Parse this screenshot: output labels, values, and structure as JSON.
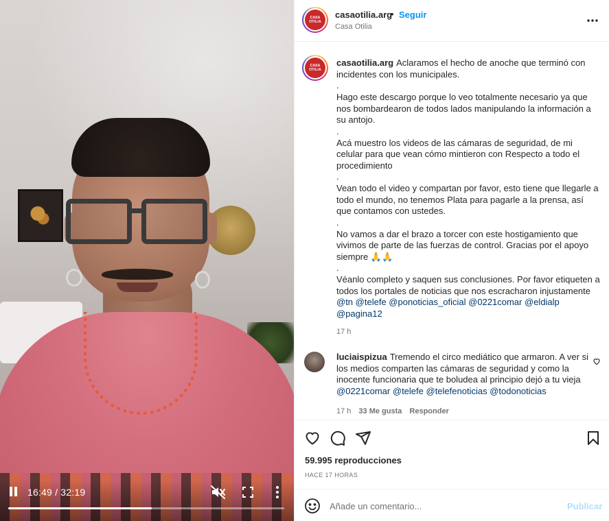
{
  "video": {
    "time": "16:49 / 32:19",
    "progress": 0.52,
    "controls": {
      "pause_icon": "pause-icon",
      "mute_icon": "volume-muted-icon",
      "fullscreen_icon": "fullscreen-icon",
      "more_icon": "more-vertical-icon"
    }
  },
  "post_header": {
    "username": "casaotilia.arg",
    "dot": "•",
    "follow_label": "Seguir",
    "subtitle": "Casa Otilia",
    "avatar_text": "CASA OTILIA",
    "more_icon": "more-horizontal-icon"
  },
  "caption": {
    "username": "casaotilia.arg",
    "paragraphs": [
      "Aclaramos el hecho de anoche que terminó con incidentes con los municipales.",
      ".",
      "Hago este descargo porque lo veo totalmente necesario ya que nos bombardearon de todos lados manipulando la información a su antojo.",
      ".",
      "Acá muestro los videos de las cámaras de seguridad, de mi celular para que vean cómo mintieron con Respecto a todo el procedimiento",
      ".",
      "Vean todo el video y compartan por favor, esto tiene que llegarle a todo el mundo, no tenemos Plata para pagarle a la prensa, así que contamos con ustedes.",
      ".",
      "No vamos a dar el brazo a torcer con este hostigamiento que vivimos de parte de las fuerzas de control. Gracias por el apoyo siempre 🙏🙏",
      ".",
      "Véanlo completo y saquen sus conclusiones. Por favor etiqueten a todos los portales de noticias que nos escracharon injustamente"
    ],
    "tags": [
      "@tn",
      "@telefe",
      "@ponoticias_oficial",
      "@0221comar",
      "@eldialp",
      "@pagina12"
    ],
    "time": "17 h"
  },
  "comment": {
    "username": "luciaispizua",
    "text": "Tremendo el circo mediático que armaron. A ver si los medios comparten las cámaras de seguridad y como la inocente funcionaria que te boludea al principio dejó a tu vieja",
    "tags": [
      "@0221comar",
      "@telefe",
      "@telefenoticias",
      "@todonoticias"
    ],
    "time": "17 h",
    "likes": "33 Me gusta",
    "reply_label": "Responder",
    "like_icon": "heart-outline-icon"
  },
  "actions": {
    "like_icon": "heart-outline-icon",
    "comment_icon": "comment-icon",
    "share_icon": "send-icon",
    "save_icon": "bookmark-icon"
  },
  "stats": {
    "views": "59.995 reproducciones",
    "ago": "HACE 17 HORAS"
  },
  "add_comment": {
    "emoji_icon": "emoji-smile-icon",
    "placeholder": "Añade un comentario...",
    "publish_label": "Publicar"
  }
}
